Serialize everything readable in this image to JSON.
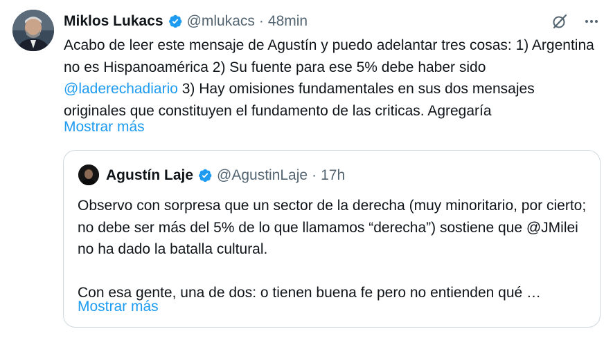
{
  "tweet": {
    "author_name": "Miklos Lukacs",
    "author_handle": "@mlukacs",
    "separator": "·",
    "time": "48min",
    "text_before_mention": "Acabo de leer este mensaje de Agustín y puedo adelantar tres cosas: 1) Argentina no es Hispanoamérica 2) Su fuente para ese 5% debe haber sido ",
    "mention": "@laderechadiario",
    "text_after_mention": " 3) Hay omisiones fundamentales en sus dos mensajes originales que constituyen el fundamento de las criticas. Agregaría",
    "show_more": "Mostrar más",
    "icons": {
      "grok": "grok-slash-icon",
      "more": "more-dots-icon",
      "verified": "verified-badge-icon"
    }
  },
  "quoted": {
    "author_name": "Agustín Laje",
    "author_handle": "@AgustinLaje",
    "separator": "·",
    "time": "17h",
    "paragraph1": "Observo con sorpresa que un sector de la derecha (muy minoritario, por cierto; no debe ser más del 5% de lo que llamamos “derecha”) sostiene que @JMilei no ha dado la batalla cultural.",
    "paragraph2": "Con esa gente, una de dos: o tienen buena fe pero no entienden qué …",
    "show_more": "Mostrar más"
  },
  "colors": {
    "text": "#0f1419",
    "secondary": "#536471",
    "accent": "#1d9bf0",
    "border": "#cfd9de"
  }
}
